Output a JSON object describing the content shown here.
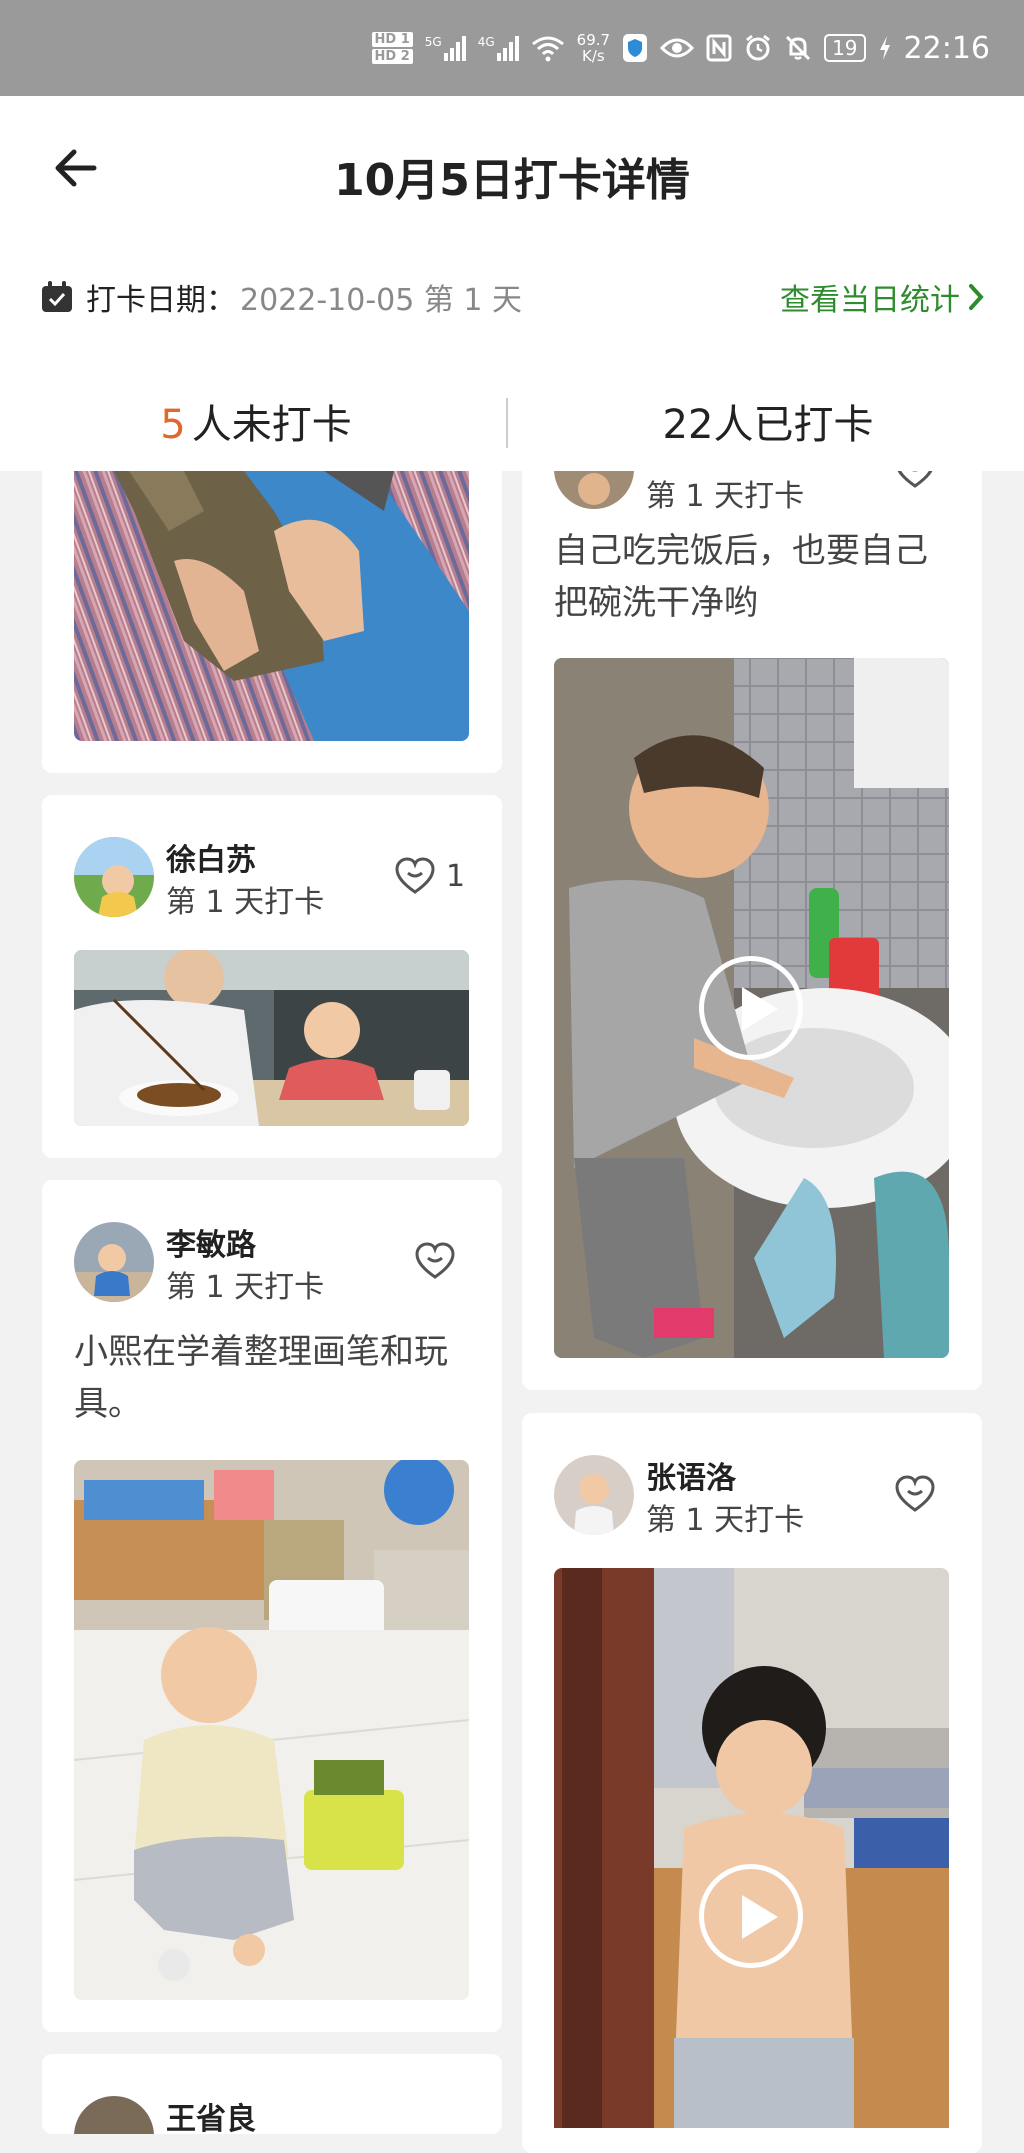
{
  "status_bar": {
    "hd1": "HD 1",
    "hd2": "HD 2",
    "sig1": "5G",
    "sig2": "4G",
    "net_speed": "69.7",
    "net_unit": "K/s",
    "battery": "19",
    "time": "22:16"
  },
  "header": {
    "title": "10月5日打卡详情",
    "date_label": "打卡日期：",
    "date_value": "2022-10-05 第 1 天",
    "stats_link": "查看当日统计"
  },
  "tabs": {
    "not_checked_count": "5",
    "not_checked_label": "人未打卡",
    "checked_label": "22人已打卡"
  },
  "feed": {
    "right_top": {
      "day": "第 1 天打卡",
      "caption": "自己吃完饭后，也要自己把碗洗干净哟"
    },
    "xu": {
      "name": "徐白苏",
      "day": "第 1 天打卡",
      "likes": "1"
    },
    "li": {
      "name": "李敏路",
      "day": "第 1 天打卡",
      "caption": "小熙在学着整理画笔和玩具。"
    },
    "zhang": {
      "name": "张语洛",
      "day": "第 1 天打卡"
    },
    "bottom_left": {
      "name": "王省良"
    }
  }
}
